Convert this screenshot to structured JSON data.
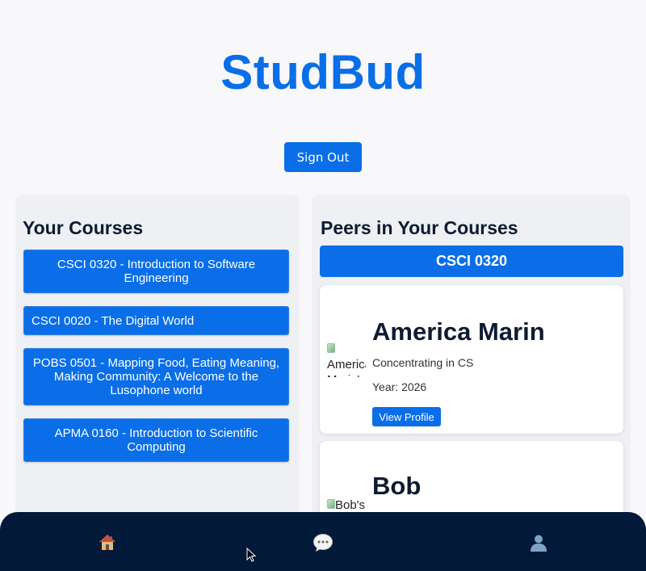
{
  "app": {
    "title": "StudBud"
  },
  "header": {
    "sign_out_label": "Sign Out"
  },
  "courses": {
    "title": "Your Courses",
    "items": [
      {
        "label": "CSCI 0320 - Introduction to Software Engineering"
      },
      {
        "label": "CSCI 0020 - The Digital World"
      },
      {
        "label": "POBS 0501 - Mapping Food, Eating Meaning, Making Community: A Welcome to the Lusophone world"
      },
      {
        "label": "APMA 0160 - Introduction to Scientific Computing"
      }
    ]
  },
  "peers": {
    "title": "Peers in Your Courses",
    "selected_course": "CSCI 0320",
    "items": [
      {
        "name": "America Marin",
        "avatar_alt": "America Marin's",
        "concentration": "Concentrating in CS",
        "year": "Year: 2026",
        "view_label": "View Profile"
      },
      {
        "name": "Bob",
        "avatar_alt": "Bob's"
      }
    ]
  },
  "nav": {
    "items": [
      {
        "icon": "house-icon"
      },
      {
        "icon": "chat-bubble-icon"
      },
      {
        "icon": "user-profile-icon"
      }
    ]
  },
  "colors": {
    "accent": "#0a6ee8",
    "nav_bg": "#03193a",
    "panel_bg": "#eef0f4"
  }
}
